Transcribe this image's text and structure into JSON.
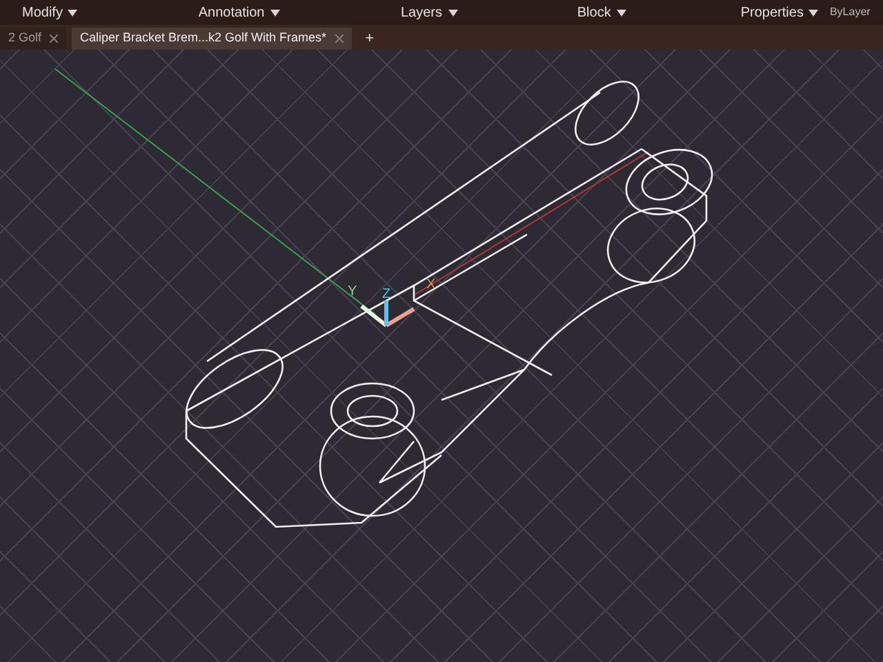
{
  "ribbon_panels": [
    {
      "label": "Modify"
    },
    {
      "label": "Annotation"
    },
    {
      "label": "Layers"
    },
    {
      "label": "Block"
    },
    {
      "label": "Properties"
    }
  ],
  "linetype": "ByLayer",
  "tabs": [
    {
      "label": "2 Golf",
      "selected": false
    },
    {
      "label": "Caliper Bracket Brem...k2 Golf With Frames*",
      "selected": true
    }
  ],
  "new_tab": "+",
  "viewport": {
    "ucs": {
      "x": "X",
      "y": "Y",
      "z": "Z"
    }
  }
}
